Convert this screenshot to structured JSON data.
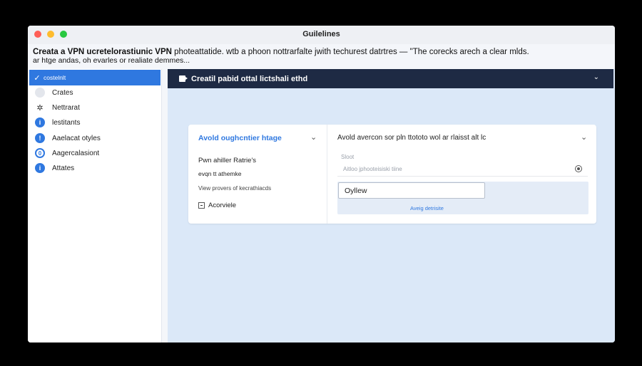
{
  "window": {
    "title": "Guilelines"
  },
  "header": {
    "line1_bold": "Creata a VPN ucretelorastiunic VPN",
    "line1_rest": " photeattatide. wtb a phoon nottrarfalte jwith techurest datrtres  —  \"The corecks arech a clear mlds.",
    "line2": "ar htge andas, oh evarles or realiate demmes..."
  },
  "sidebar": {
    "items": [
      {
        "label": "costelnlt",
        "icon": "checkmark-icon",
        "active": true
      },
      {
        "label": "Crates",
        "icon": "circle-icon",
        "active": false
      },
      {
        "label": "Nettrarat",
        "icon": "gear-icon",
        "active": false
      },
      {
        "label": "lestitants",
        "icon": "info-icon",
        "active": false
      },
      {
        "label": "Aaelacat otyles",
        "icon": "alert-icon",
        "active": false
      },
      {
        "label": "Aagercalasiont",
        "icon": "ring-icon",
        "active": false
      },
      {
        "label": "Attates",
        "icon": "info-icon",
        "active": false
      }
    ]
  },
  "main": {
    "bar_title": "Creatil pabid ottal lictshali ethd",
    "left": {
      "heading": "Avold oughcntier htage",
      "text1": "Pwn ahiller Ratrie's",
      "text2": "evqn tt athemke",
      "text3": "View provers of kecrathiacds",
      "checkbox_label": "Acorviele"
    },
    "right": {
      "heading": "Avold avercon sor pln ttototo wol ar rlaisst alt lc",
      "field_label": "Sloot",
      "field_placeholder": "Aitloo jphooteisiski tiine",
      "input_value": "Oyllew",
      "link_label": "Aveig detrisite"
    }
  },
  "colors": {
    "accent": "#2f78e0",
    "bar": "#1e2a44",
    "main_bg": "#dbe8f8"
  }
}
